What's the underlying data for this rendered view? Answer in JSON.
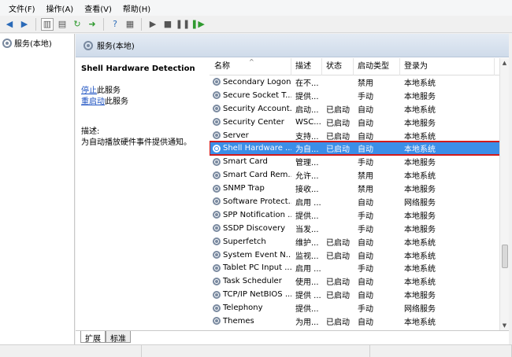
{
  "menu": [
    "文件(F)",
    "操作(A)",
    "查看(V)",
    "帮助(H)"
  ],
  "toolbar_icons": [
    "back-icon",
    "forward-icon",
    "console-tree-icon",
    "properties-icon",
    "refresh-icon",
    "export-icon",
    "help-icon",
    "view-icon",
    "play-icon",
    "stop-icon",
    "pause-icon",
    "restart-icon"
  ],
  "tree": {
    "root": "服务(本地)"
  },
  "header": {
    "title": "服务(本地)"
  },
  "detail": {
    "title": "Shell Hardware Detection",
    "stop_link": "停止",
    "stop_suffix": "此服务",
    "restart_link": "重启动",
    "restart_suffix": "此服务",
    "desc_label": "描述:",
    "desc": "为自动播放硬件事件提供通知。"
  },
  "columns": {
    "name": "名称",
    "desc": "描述",
    "status": "状态",
    "startup": "启动类型",
    "logon": "登录为"
  },
  "rows": [
    {
      "name": "Secondary Logon",
      "desc": "在不...",
      "status": "",
      "startup": "禁用",
      "logon": "本地系统"
    },
    {
      "name": "Secure Socket T...",
      "desc": "提供...",
      "status": "",
      "startup": "手动",
      "logon": "本地服务"
    },
    {
      "name": "Security Account...",
      "desc": "启动...",
      "status": "已启动",
      "startup": "自动",
      "logon": "本地系统"
    },
    {
      "name": "Security Center",
      "desc": "WSC...",
      "status": "已启动",
      "startup": "自动",
      "logon": "本地服务"
    },
    {
      "name": "Server",
      "desc": "支持...",
      "status": "已启动",
      "startup": "自动",
      "logon": "本地系统"
    },
    {
      "name": "Shell Hardware ...",
      "desc": "为自...",
      "status": "已启动",
      "startup": "自动",
      "logon": "本地系统",
      "selected": true
    },
    {
      "name": "Smart Card",
      "desc": "管理...",
      "status": "",
      "startup": "手动",
      "logon": "本地服务"
    },
    {
      "name": "Smart Card Rem...",
      "desc": "允许...",
      "status": "",
      "startup": "禁用",
      "logon": "本地系统"
    },
    {
      "name": "SNMP Trap",
      "desc": "接收...",
      "status": "",
      "startup": "禁用",
      "logon": "本地服务"
    },
    {
      "name": "Software Protect...",
      "desc": "启用 ...",
      "status": "",
      "startup": "自动",
      "logon": "网络服务"
    },
    {
      "name": "SPP Notification ...",
      "desc": "提供...",
      "status": "",
      "startup": "手动",
      "logon": "本地服务"
    },
    {
      "name": "SSDP Discovery",
      "desc": "当发...",
      "status": "",
      "startup": "手动",
      "logon": "本地服务"
    },
    {
      "name": "Superfetch",
      "desc": "维护...",
      "status": "已启动",
      "startup": "自动",
      "logon": "本地系统"
    },
    {
      "name": "System Event N...",
      "desc": "监视...",
      "status": "已启动",
      "startup": "自动",
      "logon": "本地系统"
    },
    {
      "name": "Tablet PC Input ...",
      "desc": "启用 ...",
      "status": "",
      "startup": "手动",
      "logon": "本地系统"
    },
    {
      "name": "Task Scheduler",
      "desc": "使用...",
      "status": "已启动",
      "startup": "自动",
      "logon": "本地系统"
    },
    {
      "name": "TCP/IP NetBIOS ...",
      "desc": "提供 ...",
      "status": "已启动",
      "startup": "自动",
      "logon": "本地服务"
    },
    {
      "name": "Telephony",
      "desc": "提供...",
      "status": "",
      "startup": "手动",
      "logon": "网络服务"
    },
    {
      "name": "Themes",
      "desc": "为用...",
      "status": "已启动",
      "startup": "自动",
      "logon": "本地系统"
    }
  ],
  "tabs": [
    "扩展",
    "标准"
  ],
  "colors": {
    "selection": "#3b8ee8",
    "highlight_box": "#d11a1a",
    "link": "#1a4fc0"
  }
}
